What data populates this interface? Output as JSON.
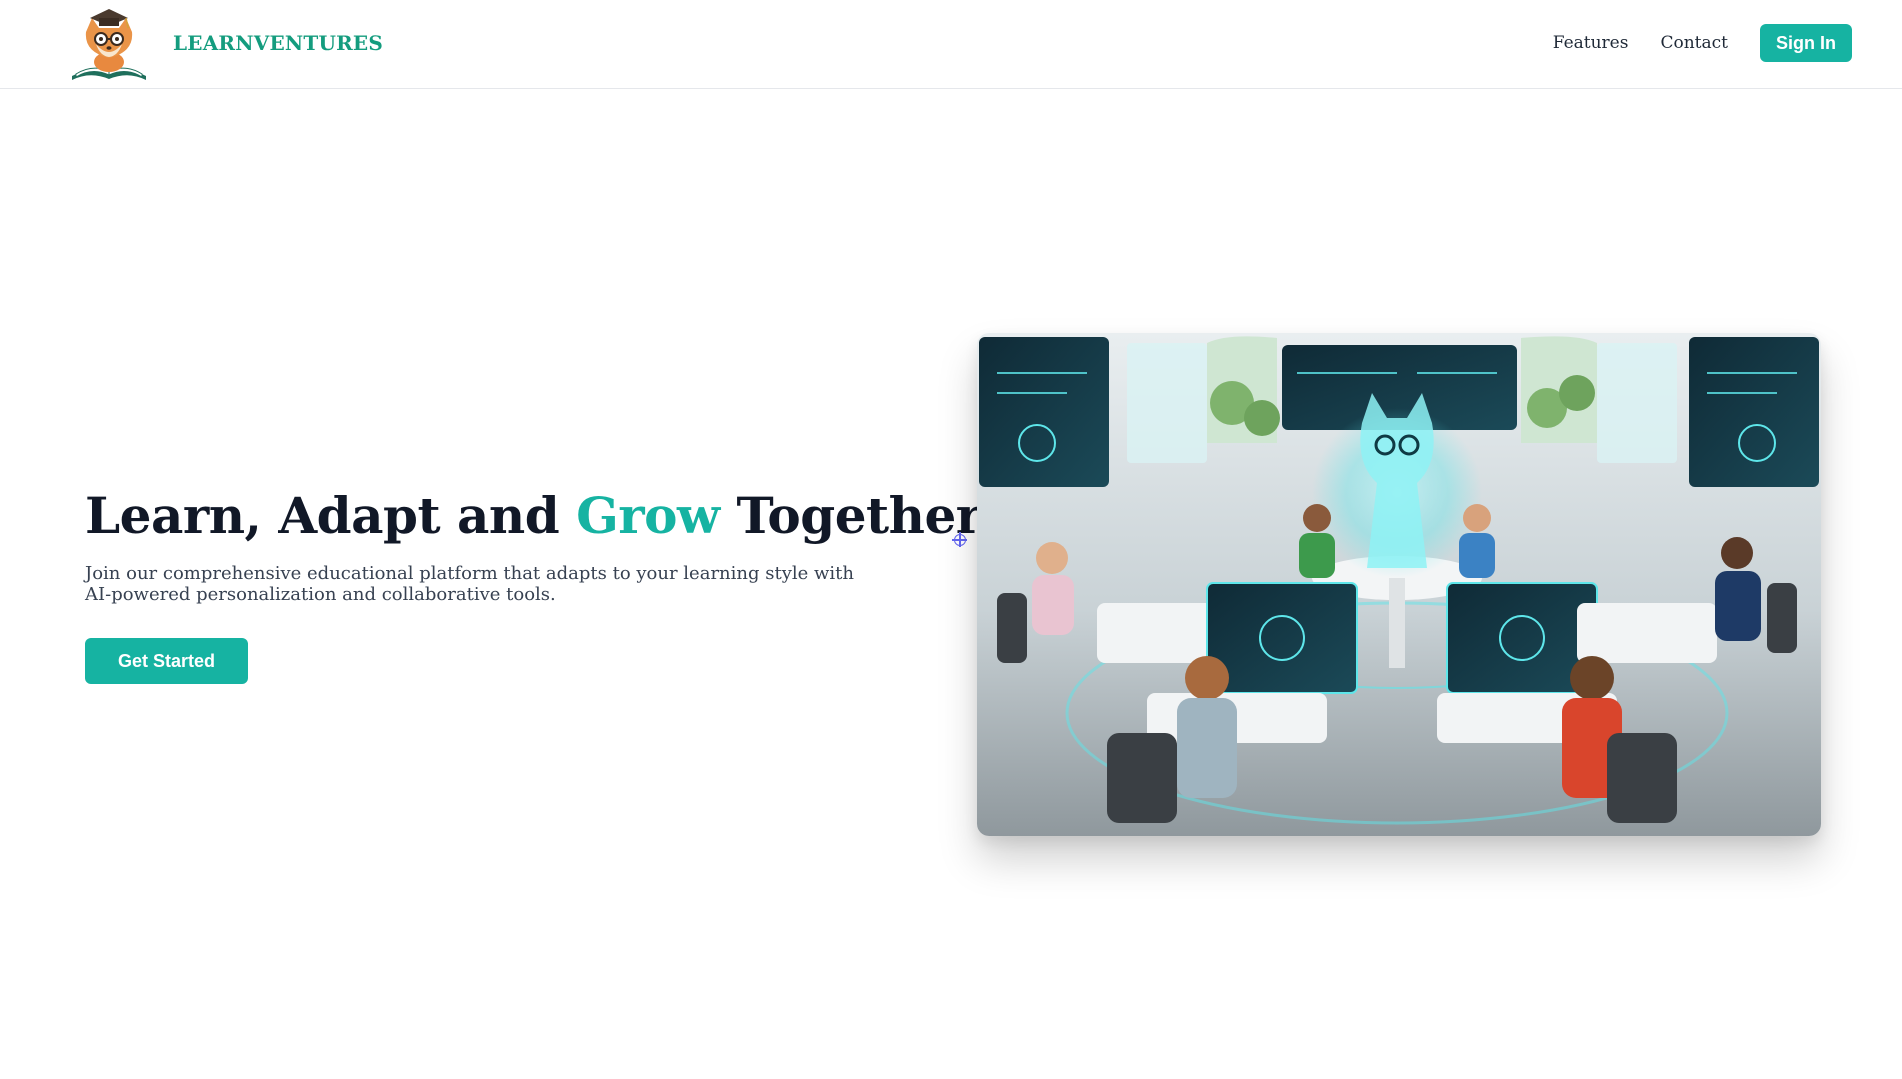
{
  "header": {
    "brand": "LEARNVENTURES",
    "nav": [
      {
        "label": "Features"
      },
      {
        "label": "Contact"
      }
    ],
    "signin_label": "Sign In"
  },
  "hero": {
    "title_part1": "Learn, Adapt and ",
    "title_accent": "Grow",
    "title_part2": " Together",
    "subtitle": "Join our comprehensive educational platform that adapts to your learning style with AI-powered personalization and collaborative tools.",
    "cta_label": "Get Started"
  },
  "colors": {
    "brand": "#149c7e",
    "accent": "#16b3a2",
    "heading": "#111827",
    "glow": "#5ee6ea"
  },
  "icons": {
    "logo": "fox-with-graduation-cap-and-book-logo",
    "hero_image": "futuristic-classroom-with-holographic-fox-illustration"
  }
}
